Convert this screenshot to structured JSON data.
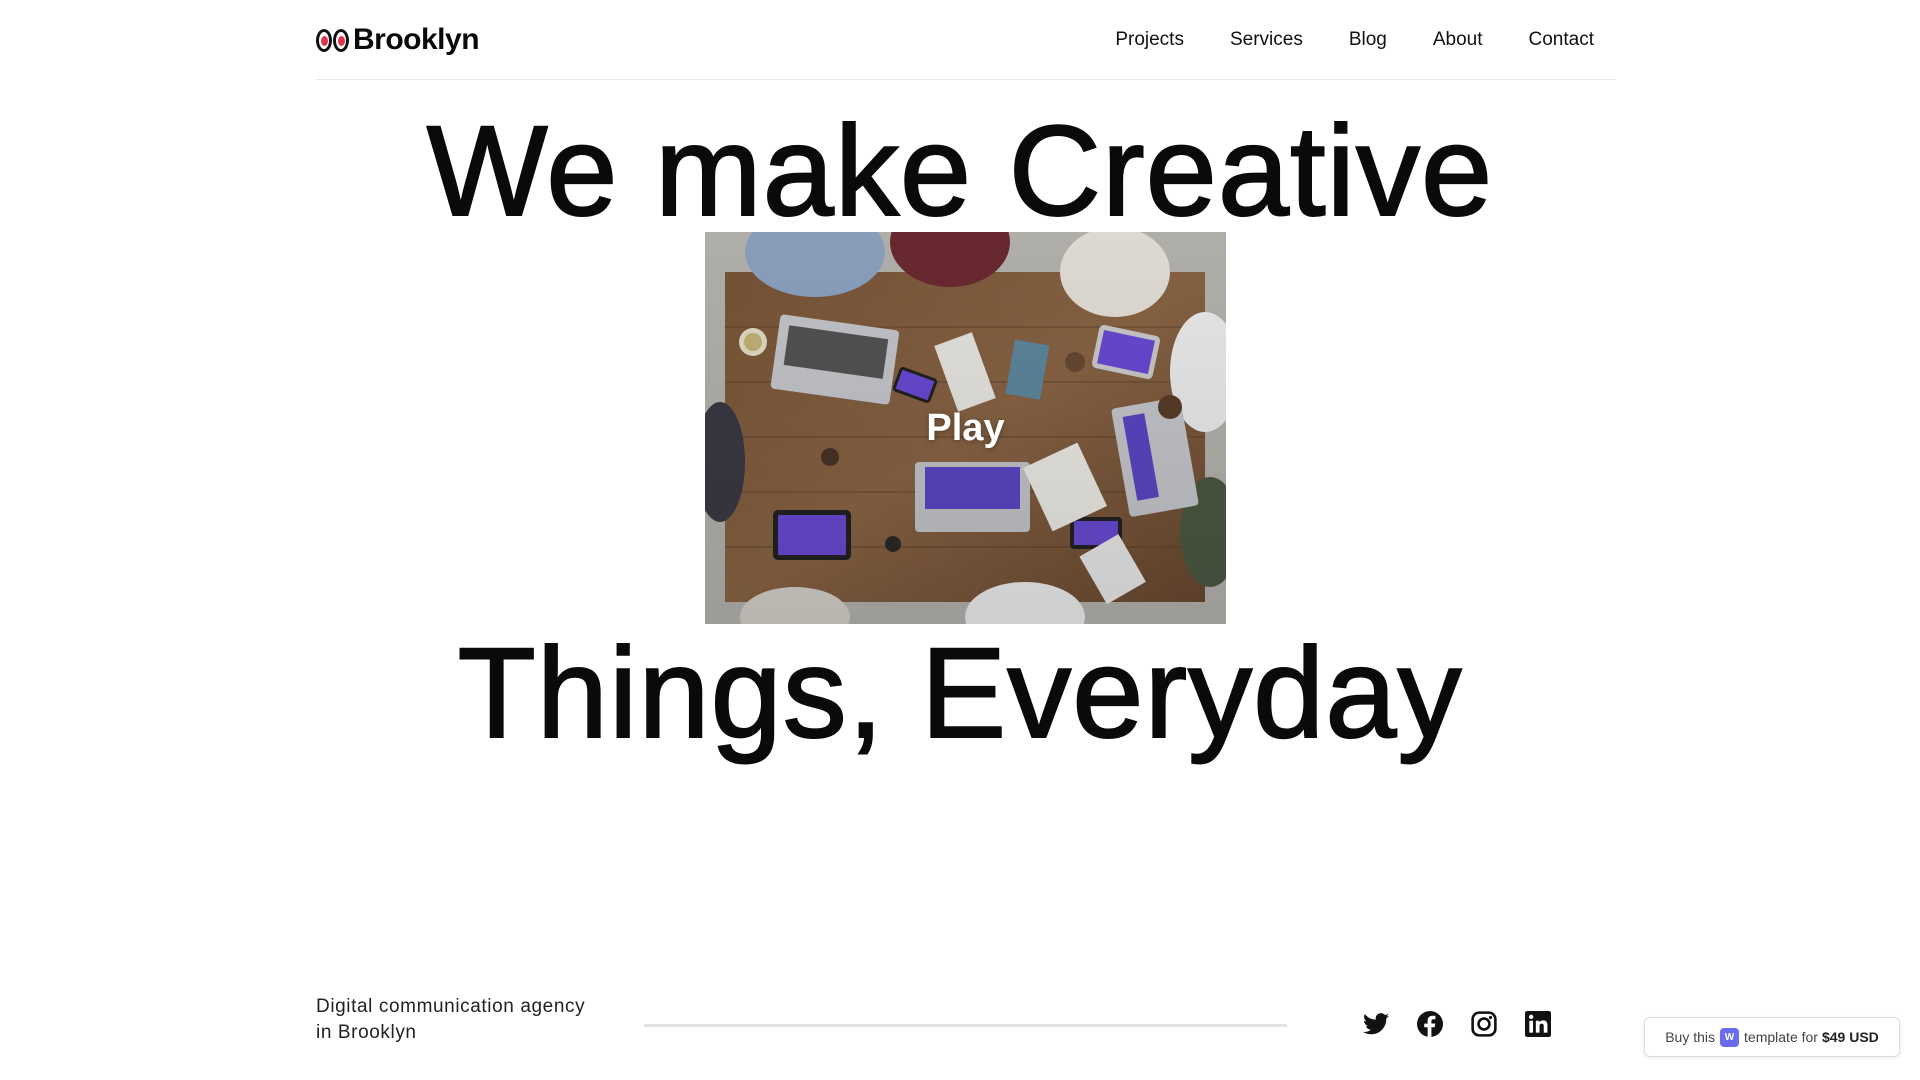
{
  "brand": {
    "name": "Brooklyn",
    "eye_color": "#e0344b"
  },
  "nav": {
    "items": [
      {
        "label": "Projects"
      },
      {
        "label": "Services"
      },
      {
        "label": "Blog"
      },
      {
        "label": "About"
      },
      {
        "label": "Contact"
      }
    ]
  },
  "hero": {
    "line1": "We make Creative",
    "line2": "Things, Everyday",
    "video": {
      "play_label": "Play",
      "thumbnail_icon": "team-meeting-photo"
    }
  },
  "footer": {
    "tagline_line1": "Digital communication agency",
    "tagline_line2": "in Brooklyn",
    "socials": [
      {
        "icon": "twitter-icon"
      },
      {
        "icon": "facebook-icon"
      },
      {
        "icon": "instagram-icon"
      },
      {
        "icon": "linkedin-icon"
      }
    ]
  },
  "badge": {
    "prefix": "Buy this",
    "middle": "template for",
    "price": "$49 USD",
    "accent": "#6a6cf0"
  }
}
